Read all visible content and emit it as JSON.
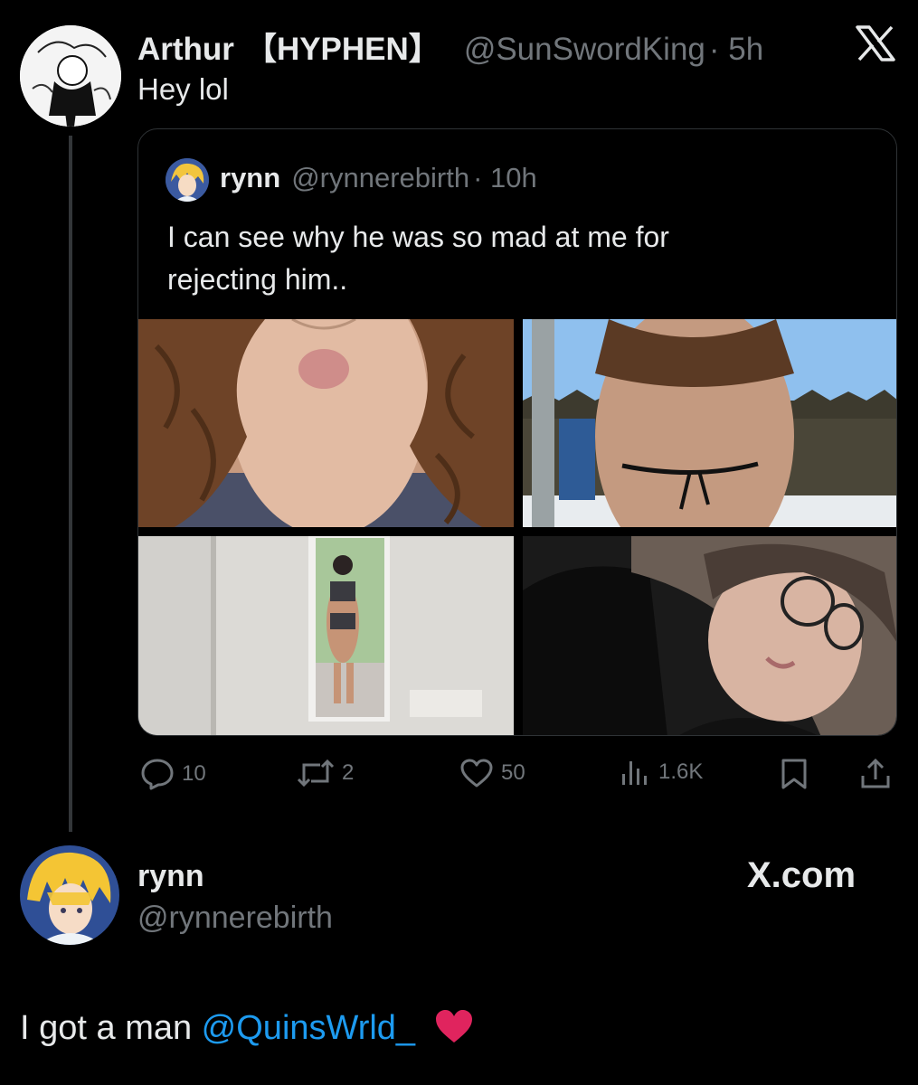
{
  "tweet": {
    "author_name": "Arthur",
    "author_badge": "【HYPHEN】",
    "handle": "@SunSwordKing",
    "time": "· 5h",
    "text": "Hey lol",
    "quoted": {
      "author_name": "rynn",
      "handle": "@rynnerebirth",
      "time": "· 10h",
      "text_line1": "I can see why he was so mad at me for",
      "text_line2": "rejecting him..",
      "media_count": 4
    },
    "actions": {
      "replies": "10",
      "reposts": "2",
      "likes": "50",
      "views": "1.6K"
    }
  },
  "reply": {
    "author_name": "rynn",
    "handle": "@rynnerebirth",
    "site": "X.com",
    "text_prefix": "I got a man ",
    "mention": "@QuinsWrld_",
    "emoji": "❤️"
  },
  "colors": {
    "background": "#000000",
    "text": "#e7e9ea",
    "muted": "#71767b",
    "accent": "#1d9bf0",
    "heart": "#e0245e"
  },
  "icons": [
    "x-logo-icon",
    "reply-icon",
    "repost-icon",
    "like-icon",
    "views-icon",
    "bookmark-icon",
    "share-icon"
  ]
}
